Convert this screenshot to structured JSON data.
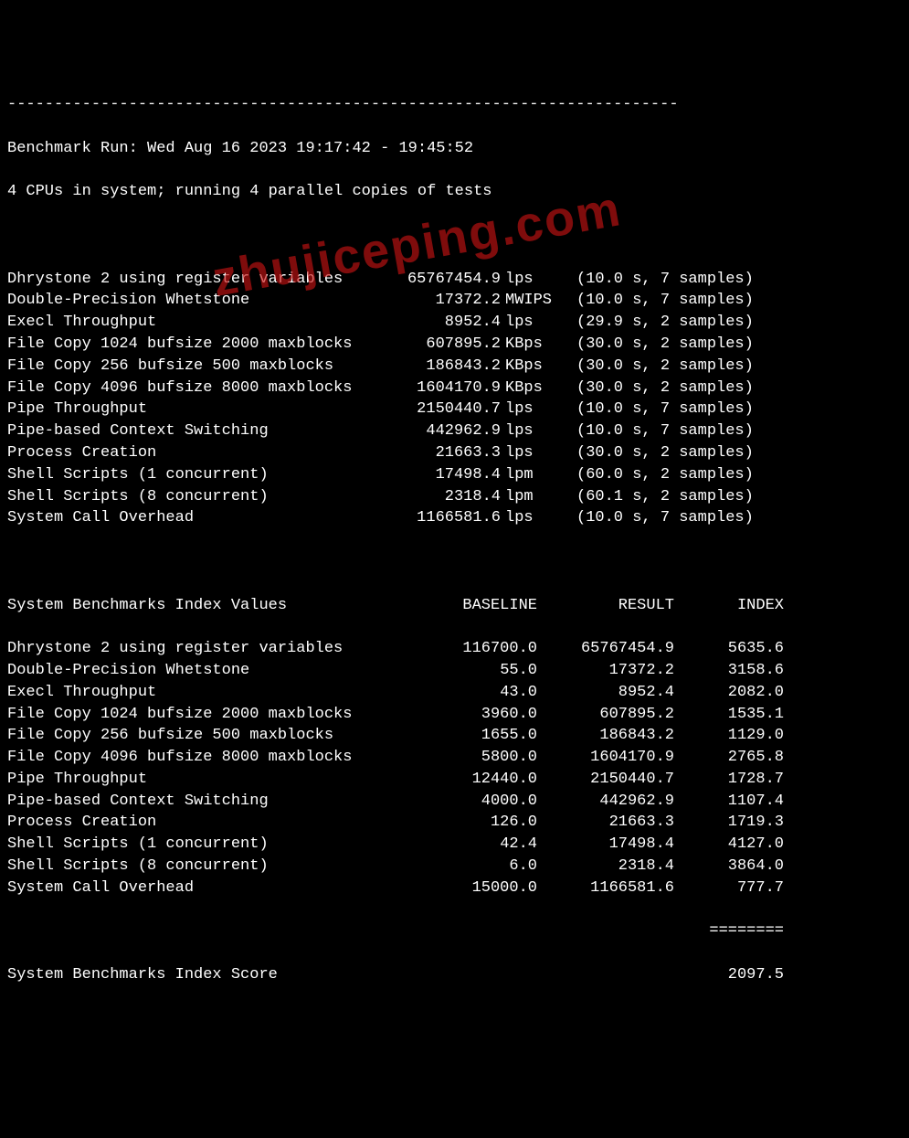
{
  "header": {
    "dash_top": "------------------------------------------------------------------------",
    "run_line": "Benchmark Run: Wed Aug 16 2023 19:17:42 - 19:45:52",
    "cpu_line": "4 CPUs in system; running 4 parallel copies of tests"
  },
  "tests": [
    {
      "name": "Dhrystone 2 using register variables",
      "value": "65767454.9",
      "unit": "lps",
      "meta": "(10.0 s, 7 samples)"
    },
    {
      "name": "Double-Precision Whetstone",
      "value": "17372.2",
      "unit": "MWIPS",
      "meta": "(10.0 s, 7 samples)"
    },
    {
      "name": "Execl Throughput",
      "value": "8952.4",
      "unit": "lps",
      "meta": "(29.9 s, 2 samples)"
    },
    {
      "name": "File Copy 1024 bufsize 2000 maxblocks",
      "value": "607895.2",
      "unit": "KBps",
      "meta": "(30.0 s, 2 samples)"
    },
    {
      "name": "File Copy 256 bufsize 500 maxblocks",
      "value": "186843.2",
      "unit": "KBps",
      "meta": "(30.0 s, 2 samples)"
    },
    {
      "name": "File Copy 4096 bufsize 8000 maxblocks",
      "value": "1604170.9",
      "unit": "KBps",
      "meta": "(30.0 s, 2 samples)"
    },
    {
      "name": "Pipe Throughput",
      "value": "2150440.7",
      "unit": "lps",
      "meta": "(10.0 s, 7 samples)"
    },
    {
      "name": "Pipe-based Context Switching",
      "value": "442962.9",
      "unit": "lps",
      "meta": "(10.0 s, 7 samples)"
    },
    {
      "name": "Process Creation",
      "value": "21663.3",
      "unit": "lps",
      "meta": "(30.0 s, 2 samples)"
    },
    {
      "name": "Shell Scripts (1 concurrent)",
      "value": "17498.4",
      "unit": "lpm",
      "meta": "(60.0 s, 2 samples)"
    },
    {
      "name": "Shell Scripts (8 concurrent)",
      "value": "2318.4",
      "unit": "lpm",
      "meta": "(60.1 s, 2 samples)"
    },
    {
      "name": "System Call Overhead",
      "value": "1166581.6",
      "unit": "lps",
      "meta": "(10.0 s, 7 samples)"
    }
  ],
  "index_header": {
    "title": "System Benchmarks Index Values",
    "baseline": "BASELINE",
    "result": "RESULT",
    "index": "INDEX"
  },
  "index": [
    {
      "name": "Dhrystone 2 using register variables",
      "baseline": "116700.0",
      "result": "65767454.9",
      "index": "5635.6"
    },
    {
      "name": "Double-Precision Whetstone",
      "baseline": "55.0",
      "result": "17372.2",
      "index": "3158.6"
    },
    {
      "name": "Execl Throughput",
      "baseline": "43.0",
      "result": "8952.4",
      "index": "2082.0"
    },
    {
      "name": "File Copy 1024 bufsize 2000 maxblocks",
      "baseline": "3960.0",
      "result": "607895.2",
      "index": "1535.1"
    },
    {
      "name": "File Copy 256 bufsize 500 maxblocks",
      "baseline": "1655.0",
      "result": "186843.2",
      "index": "1129.0"
    },
    {
      "name": "File Copy 4096 bufsize 8000 maxblocks",
      "baseline": "5800.0",
      "result": "1604170.9",
      "index": "2765.8"
    },
    {
      "name": "Pipe Throughput",
      "baseline": "12440.0",
      "result": "2150440.7",
      "index": "1728.7"
    },
    {
      "name": "Pipe-based Context Switching",
      "baseline": "4000.0",
      "result": "442962.9",
      "index": "1107.4"
    },
    {
      "name": "Process Creation",
      "baseline": "126.0",
      "result": "21663.3",
      "index": "1719.3"
    },
    {
      "name": "Shell Scripts (1 concurrent)",
      "baseline": "42.4",
      "result": "17498.4",
      "index": "4127.0"
    },
    {
      "name": "Shell Scripts (8 concurrent)",
      "baseline": "6.0",
      "result": "2318.4",
      "index": "3864.0"
    },
    {
      "name": "System Call Overhead",
      "baseline": "15000.0",
      "result": "1166581.6",
      "index": "777.7"
    }
  ],
  "eqline": "========",
  "score": {
    "label": "System Benchmarks Index Score",
    "value": "2097.5"
  },
  "watermark": "zhujiceping.com"
}
